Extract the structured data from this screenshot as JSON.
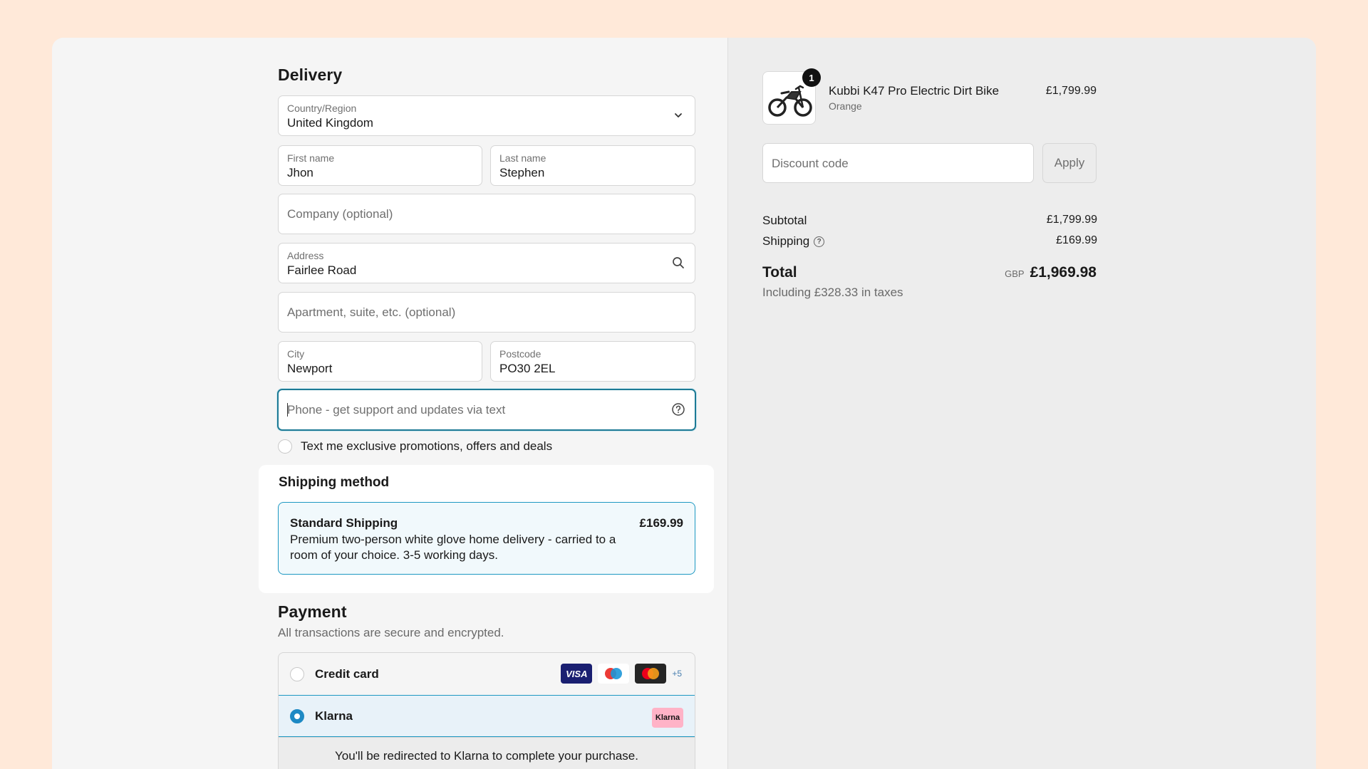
{
  "delivery": {
    "title": "Delivery",
    "country": {
      "label": "Country/Region",
      "value": "United Kingdom"
    },
    "first_name": {
      "label": "First name",
      "value": "Jhon"
    },
    "last_name": {
      "label": "Last name",
      "value": "Stephen"
    },
    "company": {
      "placeholder": "Company (optional)"
    },
    "address": {
      "label": "Address",
      "value": "Fairlee Road"
    },
    "apartment": {
      "placeholder": "Apartment, suite, etc. (optional)"
    },
    "city": {
      "label": "City",
      "value": "Newport"
    },
    "postcode": {
      "label": "Postcode",
      "value": "PO30 2EL"
    },
    "phone": {
      "placeholder": "Phone - get support and updates via text"
    },
    "sms_opt_in": "Text me exclusive promotions, offers and deals"
  },
  "shipping_method": {
    "title": "Shipping method",
    "option": {
      "name": "Standard Shipping",
      "price": "£169.99",
      "description": "Premium two-person white glove home delivery - carried to a room of your choice. 3-5 working days."
    }
  },
  "payment": {
    "title": "Payment",
    "subtitle": "All transactions are secure and encrypted.",
    "methods": [
      {
        "label": "Credit card",
        "selected": false,
        "logos": [
          "VISA",
          "maestro",
          "mastercard"
        ],
        "more": "+5"
      },
      {
        "label": "Klarna",
        "selected": true,
        "logo": "Klarna"
      }
    ],
    "klarna_note": "You'll be redirected to Klarna to complete your purchase."
  },
  "order": {
    "quantity_badge": "1",
    "item_name": "Kubbi K47 Pro Electric Dirt Bike",
    "item_variant": "Orange",
    "item_price": "£1,799.99",
    "discount_placeholder": "Discount code",
    "apply_label": "Apply",
    "subtotal_label": "Subtotal",
    "subtotal_value": "£1,799.99",
    "shipping_label": "Shipping",
    "shipping_value": "£169.99",
    "total_label": "Total",
    "currency": "GBP",
    "total_value": "£1,969.98",
    "tax_note": "Including £328.33 in taxes"
  },
  "colors": {
    "page_bg": "#ffe9d9",
    "accent": "#1d98c2",
    "focus": "#1d7a95"
  }
}
